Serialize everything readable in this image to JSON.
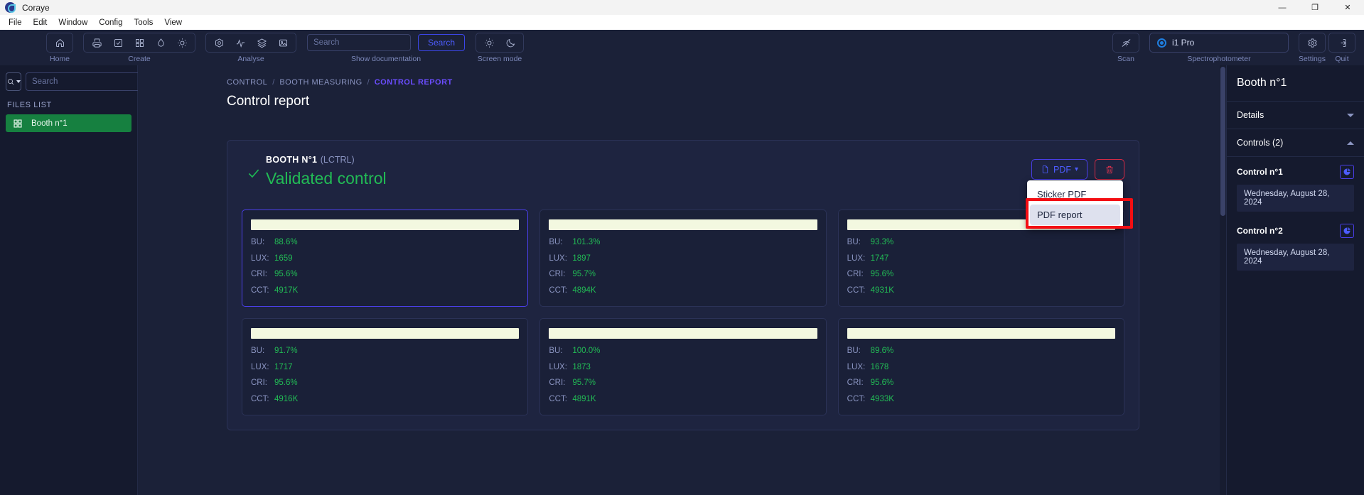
{
  "window": {
    "app_title": "Coraye",
    "logo_icon": "coraye-logo-icon",
    "minimize_label": "—",
    "maximize_label": "❐",
    "close_label": "✕"
  },
  "menubar": {
    "items": [
      {
        "label": "File"
      },
      {
        "label": "Edit"
      },
      {
        "label": "Window"
      },
      {
        "label": "Config"
      },
      {
        "label": "Tools"
      },
      {
        "label": "View"
      }
    ]
  },
  "ribbon": {
    "groups": [
      {
        "label": "Home",
        "buttons": [
          {
            "icon": "home-icon",
            "name": "home-button"
          }
        ]
      },
      {
        "label": "Create",
        "buttons": [
          {
            "icon": "print-icon",
            "name": "print-button"
          },
          {
            "icon": "checkbox-task-icon",
            "name": "task-button"
          },
          {
            "icon": "grid-icon",
            "name": "grid-button"
          },
          {
            "icon": "droplet-icon",
            "name": "droplet-button"
          },
          {
            "icon": "sun-icon",
            "name": "brightness-button"
          }
        ]
      },
      {
        "label": "Analyse",
        "buttons": [
          {
            "icon": "color-wheel-icon",
            "name": "color-analysis-button"
          },
          {
            "icon": "waveform-icon",
            "name": "waveform-button"
          },
          {
            "icon": "layers-icon",
            "name": "layers-button"
          },
          {
            "icon": "image-icon",
            "name": "image-button"
          }
        ]
      }
    ],
    "search": {
      "placeholder": "Search",
      "value": "",
      "button_label": "Search",
      "label": "Show documentation"
    },
    "screen_mode": {
      "label": "Screen mode",
      "light_icon": "sun-icon",
      "dark_icon": "moon-icon"
    },
    "scan": {
      "label": "Scan",
      "icon": "scan-disabled-icon"
    },
    "spectrophotometer": {
      "label": "Spectrophotometer",
      "device": "i1 Pro",
      "status_icon": "radio-selected-icon"
    },
    "settings": {
      "label": "Settings",
      "icon": "gear-icon"
    },
    "quit": {
      "label": "Quit",
      "icon": "exit-icon"
    }
  },
  "sidebar": {
    "filter_icon": "search-filter-icon",
    "search_placeholder": "Search",
    "search_value": "",
    "files_list_heading": "FILES LIST",
    "files": [
      {
        "label": "Booth n°1",
        "icon": "grid-icon",
        "selected": true
      }
    ]
  },
  "breadcrumb": {
    "items": [
      {
        "label": "CONTROL",
        "active": false
      },
      {
        "label": "BOOTH MEASURING",
        "active": false
      },
      {
        "label": "CONTROL REPORT",
        "active": true
      }
    ],
    "separator": "/"
  },
  "page": {
    "title": "Control report"
  },
  "report": {
    "check_icon": "check-icon",
    "booth_name": "BOOTH N°1",
    "booth_type": "(LCTRL)",
    "status": "Validated control",
    "pdf_button": {
      "label": "PDF",
      "icon": "document-icon",
      "caret": "▾"
    },
    "delete_button": {
      "icon": "trash-icon"
    },
    "pdf_menu": {
      "items": [
        {
          "label": "Sticker PDF",
          "selected": false
        },
        {
          "label": "PDF report",
          "selected": true
        }
      ]
    }
  },
  "measurements": {
    "keys": {
      "bu": "BU:",
      "lux": "LUX:",
      "cri": "CRI:",
      "cct": "CCT:"
    },
    "cards": [
      {
        "bu": "88.6%",
        "lux": "1659",
        "cri": "95.6%",
        "cct": "4917K",
        "highlight": true
      },
      {
        "bu": "101.3%",
        "lux": "1897",
        "cri": "95.7%",
        "cct": "4894K",
        "highlight": false
      },
      {
        "bu": "93.3%",
        "lux": "1747",
        "cri": "95.6%",
        "cct": "4931K",
        "highlight": false
      },
      {
        "bu": "91.7%",
        "lux": "1717",
        "cri": "95.6%",
        "cct": "4916K",
        "highlight": false
      },
      {
        "bu": "100.0%",
        "lux": "1873",
        "cri": "95.7%",
        "cct": "4891K",
        "highlight": false
      },
      {
        "bu": "89.6%",
        "lux": "1678",
        "cri": "95.6%",
        "cct": "4933K",
        "highlight": false
      }
    ]
  },
  "rightpanel": {
    "title": "Booth n°1",
    "sections": [
      {
        "label": "Details",
        "expanded": false
      },
      {
        "label": "Controls (2)",
        "expanded": true
      }
    ],
    "controls": [
      {
        "label": "Control n°1",
        "date": "Wednesday, August 28, 2024",
        "icon": "pie-chart-icon"
      },
      {
        "label": "Control n°2",
        "date": "Wednesday, August 28, 2024",
        "icon": "pie-chart-icon"
      }
    ]
  },
  "colors": {
    "accent_blue": "#4d5cff",
    "success_green": "#22bb55",
    "danger_red": "#e8344f",
    "breadcrumb_active": "#6b4dff",
    "file_selected": "#168040",
    "focus_ring": "#f40e13"
  }
}
